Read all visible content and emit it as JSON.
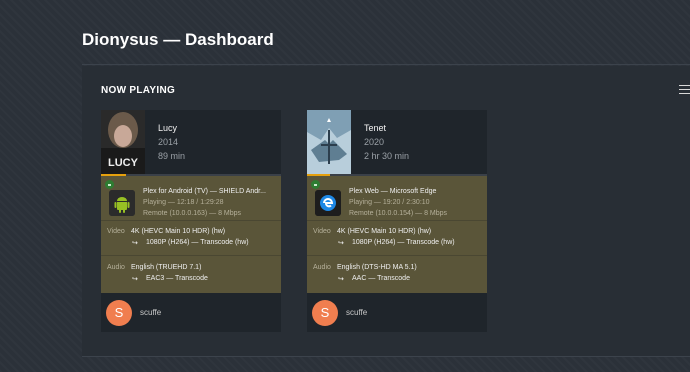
{
  "page": {
    "title": "Dionysus — Dashboard"
  },
  "section": {
    "title": "NOW PLAYING"
  },
  "colors": {
    "accent": "#e5a00d",
    "session_bg": "#5a5539",
    "avatar": "#f07e4f",
    "secure": "#2e7d32"
  },
  "sessions": [
    {
      "title": "Lucy",
      "year": "2014",
      "duration": "89 min",
      "progress": 0.14,
      "player": {
        "name": "Plex for Android (TV)  —  SHIELD Andr...",
        "icon": "android-icon",
        "state": "Playing — 12:18 / 1:29:28",
        "remote": "Remote (10.0.0.163) — 8 Mbps"
      },
      "video_label": "Video",
      "video": "4K (HEVC Main 10 HDR) (hw)",
      "video_sub": "1080P (H264) — Transcode (hw)",
      "audio_label": "Audio",
      "audio": "English (TRUEHD 7.1)",
      "audio_sub": "EAC3 — Transcode",
      "user_initial": "S",
      "user": "scuffe"
    },
    {
      "title": "Tenet",
      "year": "2020",
      "duration": "2 hr 30 min",
      "progress": 0.13,
      "player": {
        "name": "Plex Web  —  Microsoft Edge",
        "icon": "edge-icon",
        "state": "Playing — 19:20 / 2:30:10",
        "remote": "Remote (10.0.0.154) — 8 Mbps"
      },
      "video_label": "Video",
      "video": "4K (HEVC Main 10 HDR) (hw)",
      "video_sub": "1080P (H264) — Transcode (hw)",
      "audio_label": "Audio",
      "audio": "English (DTS-HD MA 5.1)",
      "audio_sub": "AAC — Transcode",
      "user_initial": "S",
      "user": "scuffe"
    }
  ]
}
